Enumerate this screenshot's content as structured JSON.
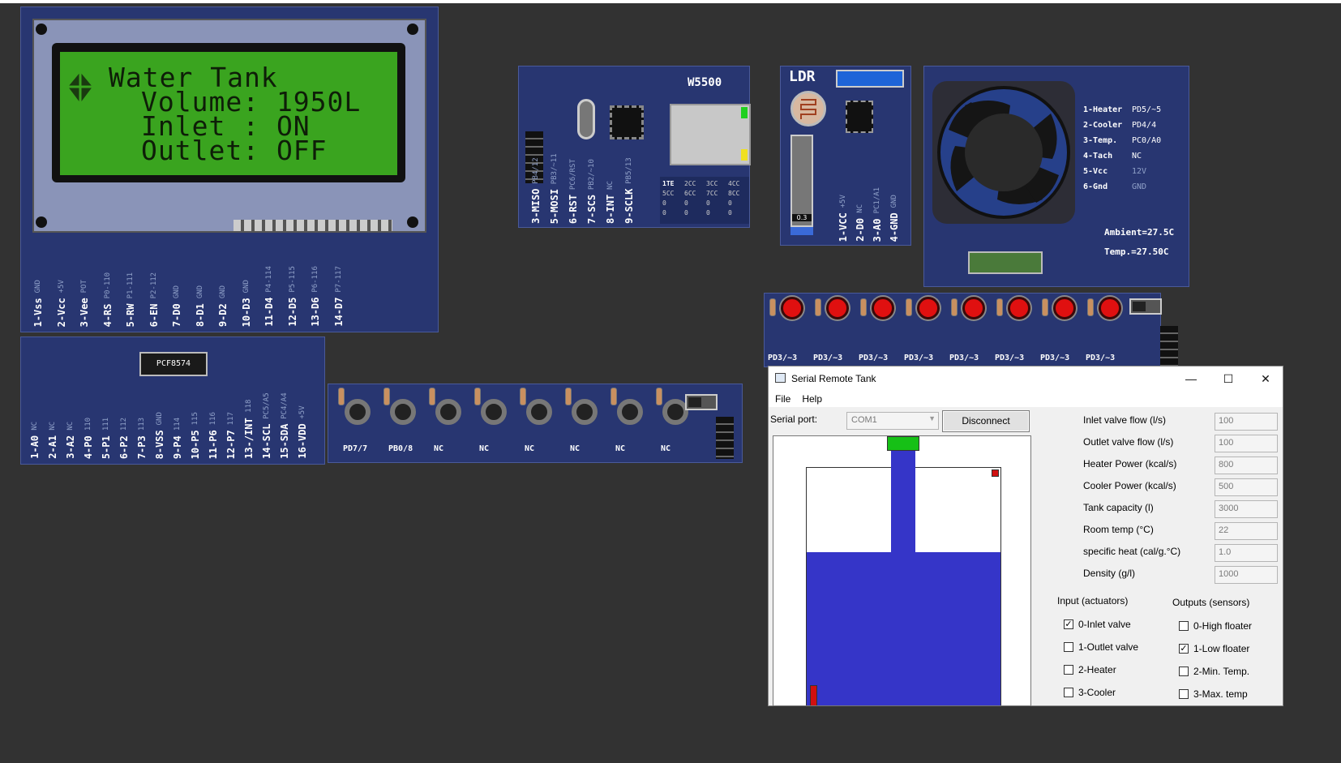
{
  "lcd": {
    "line1": "Water Tank",
    "line2": "Volume: 1950L",
    "line3": "Inlet : ON",
    "line4": "Outlet: OFF",
    "pins": [
      {
        "name": "1-Vss",
        "sub": "GND"
      },
      {
        "name": "2-Vcc",
        "sub": "+5V"
      },
      {
        "name": "3-Vee",
        "sub": "POT"
      },
      {
        "name": "4-RS",
        "sub": "P0-110"
      },
      {
        "name": "5-RW",
        "sub": "P1-111"
      },
      {
        "name": "6-EN",
        "sub": "P2-112"
      },
      {
        "name": "7-D0",
        "sub": "GND"
      },
      {
        "name": "8-D1",
        "sub": "GND"
      },
      {
        "name": "9-D2",
        "sub": "GND"
      },
      {
        "name": "10-D3",
        "sub": "GND"
      },
      {
        "name": "11-D4",
        "sub": "P4-114"
      },
      {
        "name": "12-D5",
        "sub": "P5-115"
      },
      {
        "name": "13-D6",
        "sub": "P6-116"
      },
      {
        "name": "14-D7",
        "sub": "P7-117"
      }
    ]
  },
  "pcf": {
    "chip": "PCF8574",
    "pins": [
      {
        "name": "1-A0",
        "sub": "NC"
      },
      {
        "name": "2-A1",
        "sub": "NC"
      },
      {
        "name": "3-A2",
        "sub": "NC"
      },
      {
        "name": "4-P0",
        "sub": "110"
      },
      {
        "name": "5-P1",
        "sub": "111"
      },
      {
        "name": "6-P2",
        "sub": "112"
      },
      {
        "name": "7-P3",
        "sub": "113"
      },
      {
        "name": "8-VSS",
        "sub": "GND"
      },
      {
        "name": "9-P4",
        "sub": "114"
      },
      {
        "name": "10-P5",
        "sub": "115"
      },
      {
        "name": "11-P6",
        "sub": "116"
      },
      {
        "name": "12-P7",
        "sub": "117"
      },
      {
        "name": "13-/INT",
        "sub": "118"
      },
      {
        "name": "14-SCL",
        "sub": "PC5/A5"
      },
      {
        "name": "15-SDA",
        "sub": "PC4/A4"
      },
      {
        "name": "16-VDD",
        "sub": "+5V"
      }
    ]
  },
  "buttons": {
    "labels": [
      "PD7/7",
      "PB0/8",
      "NC",
      "NC",
      "NC",
      "NC",
      "NC",
      "NC"
    ]
  },
  "w5500": {
    "title": "W5500",
    "pins": [
      {
        "name": "3-MISO",
        "sub": "PB4/12"
      },
      {
        "name": "5-MOSI",
        "sub": "PB3/~11"
      },
      {
        "name": "6-RST",
        "sub": "PC6/RST"
      },
      {
        "name": "7-SCS",
        "sub": "PB2/~10"
      },
      {
        "name": "8-INT",
        "sub": "NC"
      },
      {
        "name": "9-SCLK",
        "sub": "PB5/13"
      }
    ],
    "table_headers": [
      "1TE",
      "2CC",
      "3CC",
      "4CC"
    ],
    "table_headers2": [
      "5CC",
      "6CC",
      "7CC",
      "8CC"
    ],
    "table_row1": [
      "0",
      "0",
      "0",
      "0"
    ],
    "table_row2": [
      "0",
      "0",
      "0",
      "0"
    ]
  },
  "ldr": {
    "title": "LDR",
    "value": "0.3",
    "pins": [
      {
        "name": "1-VCC",
        "sub": "+5V"
      },
      {
        "name": "2-D0",
        "sub": "NC"
      },
      {
        "name": "3-A0",
        "sub": "PC1/A1"
      },
      {
        "name": "4-GND",
        "sub": "GND"
      }
    ]
  },
  "fan": {
    "pins": [
      {
        "name": "1-Heater",
        "val": "PD5/~5",
        "dim": false
      },
      {
        "name": "2-Cooler",
        "val": "PD4/4",
        "dim": false
      },
      {
        "name": "3-Temp.",
        "val": "PC0/A0",
        "dim": false
      },
      {
        "name": "4-Tach",
        "val": "NC",
        "dim": false
      },
      {
        "name": "5-Vcc",
        "val": "12V",
        "dim": true
      },
      {
        "name": "6-Gnd",
        "val": "GND",
        "dim": true
      }
    ],
    "ambient": "Ambient=27.5C",
    "temp": "Temp.=27.50C"
  },
  "leds": {
    "labels": [
      "PD3/~3",
      "PD3/~3",
      "PD3/~3",
      "PD3/~3",
      "PD3/~3",
      "PD3/~3",
      "PD3/~3",
      "PD3/~3"
    ]
  },
  "window": {
    "title": "Serial Remote Tank",
    "menu_file": "File",
    "menu_help": "Help",
    "serial_label": "Serial port:",
    "serial_value": "COM1",
    "disconnect": "Disconnect",
    "fields": [
      {
        "label": "Inlet valve flow (l/s)",
        "value": "100"
      },
      {
        "label": "Outlet valve flow (l/s)",
        "value": "100"
      },
      {
        "label": "Heater Power (kcal/s)",
        "value": "800"
      },
      {
        "label": "Cooler Power (kcal/s)",
        "value": "500"
      },
      {
        "label": "Tank capacity (l)",
        "value": "3000"
      },
      {
        "label": "Room temp (°C)",
        "value": "22"
      },
      {
        "label": "specific heat (cal/g.°C)",
        "value": "1.0"
      },
      {
        "label": "Density (g/l)",
        "value": "1000"
      }
    ],
    "inputs_title": "Input (actuators)",
    "outputs_title": "Outputs (sensors)",
    "inputs": [
      {
        "label": "0-Inlet valve",
        "checked": true
      },
      {
        "label": "1-Outlet valve",
        "checked": false
      },
      {
        "label": "2-Heater",
        "checked": false
      },
      {
        "label": "3-Cooler",
        "checked": false
      }
    ],
    "outputs": [
      {
        "label": "0-High floater",
        "checked": false
      },
      {
        "label": "1-Low floater",
        "checked": true
      },
      {
        "label": "2-Min. Temp.",
        "checked": false
      },
      {
        "label": "3-Max. temp",
        "checked": false
      }
    ],
    "tank_fill": 0.65
  },
  "colors": {
    "board": "#283671",
    "lcd_green": "#3aa41f",
    "water": "#3535c8",
    "led_red": "#e01010"
  }
}
